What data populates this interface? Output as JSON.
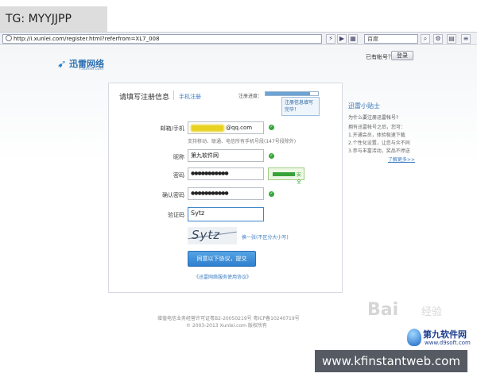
{
  "overlay_tag": "TG: MYYJJPP",
  "browser": {
    "address": "http://i.xunlei.com/register.html?referfrom=XL7_008",
    "search_engine": "百度",
    "icons": [
      "lightning-icon",
      "play-icon",
      "grid-icon",
      "search-icon",
      "tools-icon",
      "feed-icon"
    ]
  },
  "header": {
    "logo_text": "迅雷网络",
    "logo_domain": "i.xunlei.com",
    "has_account": "已有帐号？",
    "login_button": "登录"
  },
  "form": {
    "title": "请填写注册信息",
    "phone_register": "手机注册",
    "progress_label": "注册进度：",
    "progress_fraction": 0.85,
    "progress_tip": "注册信息填写完毕！",
    "fields": {
      "email": {
        "label": "邮箱/手机",
        "domain": "@qq.com",
        "hint": "支持移动、联通、电信所有手机号段(147号段除外)"
      },
      "nickname": {
        "label": "昵称",
        "value": "第九软件网"
      },
      "password": {
        "label": "密码",
        "value": "●●●●●●●●●●●",
        "strength": "安全"
      },
      "confirm": {
        "label": "确认密码",
        "value": "●●●●●●●●●●●"
      },
      "captcha": {
        "label": "验证码",
        "value": "Sytz",
        "image_code": "Sytz",
        "refresh": "换一张(不区分大小写)"
      }
    },
    "submit": "同意以下协议，提交",
    "agreement": "《迅雷网络服务使用协议》"
  },
  "sidebar": {
    "title": "迅雷小贴士",
    "question": "为什么要注册迅雷帐号?",
    "lines": [
      "拥有迅雷帐号之后，您可：",
      "1.开通会员，体验极速下载",
      "2.个性化设置，让您与众不同",
      "3.参与丰富活动，奖品不停送"
    ],
    "more": "了解更多>>"
  },
  "footer": {
    "line1": "增值电信业务经营许可证粤B2-20050219号 粤ICP备10240719号",
    "line2": "© 2003-2013 Xunlei.com 版权所有"
  },
  "watermarks": {
    "baidu": "Bai",
    "baidu_jingyan": "经验",
    "site_name": "第九软件网",
    "site_domain": "www.d9soft.com",
    "banner": "www.kfinstantweb.com"
  },
  "colors": {
    "brand_blue": "#2e7fcf",
    "ok_green": "#35a63b",
    "email_highlight": "#e8d21f"
  }
}
